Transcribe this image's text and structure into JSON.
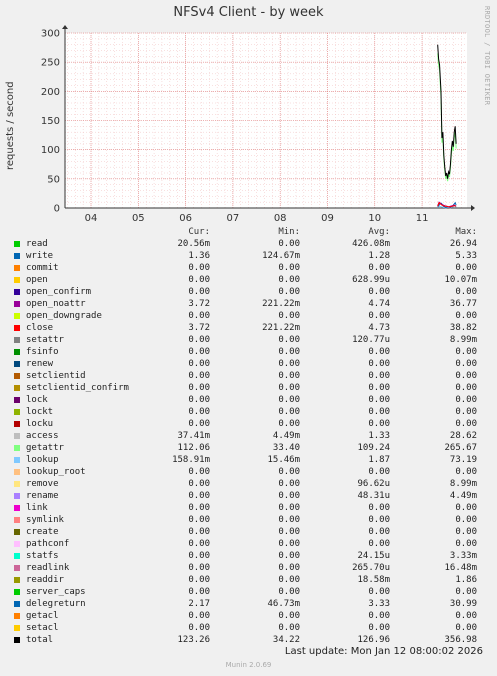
{
  "title": "NFSv4 Client - by week",
  "side_text": "RRDTOOL / TOBI OETIKER",
  "footer": {
    "last_update": "Last update: Mon Jan 12 08:00:02 2026",
    "version": "Munin 2.0.69"
  },
  "legend_headers": [
    "Cur:",
    "Min:",
    "Avg:",
    "Max:"
  ],
  "legend": [
    {
      "name": "read",
      "color": "#00cc00",
      "cur": "20.56m",
      "min": "0.00",
      "avg": "426.08m",
      "max": "26.94"
    },
    {
      "name": "write",
      "color": "#0066b3",
      "cur": "1.36",
      "min": "124.67m",
      "avg": "1.28",
      "max": "5.33"
    },
    {
      "name": "commit",
      "color": "#ff8000",
      "cur": "0.00",
      "min": "0.00",
      "avg": "0.00",
      "max": "0.00"
    },
    {
      "name": "open",
      "color": "#ffcc00",
      "cur": "0.00",
      "min": "0.00",
      "avg": "628.99u",
      "max": "10.07m"
    },
    {
      "name": "open_confirm",
      "color": "#330099",
      "cur": "0.00",
      "min": "0.00",
      "avg": "0.00",
      "max": "0.00"
    },
    {
      "name": "open_noattr",
      "color": "#990099",
      "cur": "3.72",
      "min": "221.22m",
      "avg": "4.74",
      "max": "36.77"
    },
    {
      "name": "open_downgrade",
      "color": "#ccff00",
      "cur": "0.00",
      "min": "0.00",
      "avg": "0.00",
      "max": "0.00"
    },
    {
      "name": "close",
      "color": "#ff0000",
      "cur": "3.72",
      "min": "221.22m",
      "avg": "4.73",
      "max": "38.82"
    },
    {
      "name": "setattr",
      "color": "#808080",
      "cur": "0.00",
      "min": "0.00",
      "avg": "120.77u",
      "max": "8.99m"
    },
    {
      "name": "fsinfo",
      "color": "#008f00",
      "cur": "0.00",
      "min": "0.00",
      "avg": "0.00",
      "max": "0.00"
    },
    {
      "name": "renew",
      "color": "#00487d",
      "cur": "0.00",
      "min": "0.00",
      "avg": "0.00",
      "max": "0.00"
    },
    {
      "name": "setclientid",
      "color": "#b35a00",
      "cur": "0.00",
      "min": "0.00",
      "avg": "0.00",
      "max": "0.00"
    },
    {
      "name": "setclientid_confirm",
      "color": "#b38f00",
      "cur": "0.00",
      "min": "0.00",
      "avg": "0.00",
      "max": "0.00"
    },
    {
      "name": "lock",
      "color": "#6b006b",
      "cur": "0.00",
      "min": "0.00",
      "avg": "0.00",
      "max": "0.00"
    },
    {
      "name": "lockt",
      "color": "#8fb300",
      "cur": "0.00",
      "min": "0.00",
      "avg": "0.00",
      "max": "0.00"
    },
    {
      "name": "locku",
      "color": "#b30000",
      "cur": "0.00",
      "min": "0.00",
      "avg": "0.00",
      "max": "0.00"
    },
    {
      "name": "access",
      "color": "#bebebe",
      "cur": "37.41m",
      "min": "4.49m",
      "avg": "1.33",
      "max": "28.62"
    },
    {
      "name": "getattr",
      "color": "#80ff80",
      "cur": "112.06",
      "min": "33.40",
      "avg": "109.24",
      "max": "265.67"
    },
    {
      "name": "lookup",
      "color": "#80c9ff",
      "cur": "158.91m",
      "min": "15.46m",
      "avg": "1.87",
      "max": "73.19"
    },
    {
      "name": "lookup_root",
      "color": "#ffc080",
      "cur": "0.00",
      "min": "0.00",
      "avg": "0.00",
      "max": "0.00"
    },
    {
      "name": "remove",
      "color": "#ffe680",
      "cur": "0.00",
      "min": "0.00",
      "avg": "96.62u",
      "max": "8.99m"
    },
    {
      "name": "rename",
      "color": "#aa80ff",
      "cur": "0.00",
      "min": "0.00",
      "avg": "48.31u",
      "max": "4.49m"
    },
    {
      "name": "link",
      "color": "#ee00cc",
      "cur": "0.00",
      "min": "0.00",
      "avg": "0.00",
      "max": "0.00"
    },
    {
      "name": "symlink",
      "color": "#ff8080",
      "cur": "0.00",
      "min": "0.00",
      "avg": "0.00",
      "max": "0.00"
    },
    {
      "name": "create",
      "color": "#666600",
      "cur": "0.00",
      "min": "0.00",
      "avg": "0.00",
      "max": "0.00"
    },
    {
      "name": "pathconf",
      "color": "#ffbfff",
      "cur": "0.00",
      "min": "0.00",
      "avg": "0.00",
      "max": "0.00"
    },
    {
      "name": "statfs",
      "color": "#00ffcc",
      "cur": "0.00",
      "min": "0.00",
      "avg": "24.15u",
      "max": "3.33m"
    },
    {
      "name": "readlink",
      "color": "#cc6699",
      "cur": "0.00",
      "min": "0.00",
      "avg": "265.70u",
      "max": "16.48m"
    },
    {
      "name": "readdir",
      "color": "#999900",
      "cur": "0.00",
      "min": "0.00",
      "avg": "18.58m",
      "max": "1.86"
    },
    {
      "name": "server_caps",
      "color": "#00cc00",
      "cur": "0.00",
      "min": "0.00",
      "avg": "0.00",
      "max": "0.00"
    },
    {
      "name": "delegreturn",
      "color": "#0066b3",
      "cur": "2.17",
      "min": "46.73m",
      "avg": "3.33",
      "max": "30.99"
    },
    {
      "name": "getacl",
      "color": "#ff8000",
      "cur": "0.00",
      "min": "0.00",
      "avg": "0.00",
      "max": "0.00"
    },
    {
      "name": "setacl",
      "color": "#ffcc00",
      "cur": "0.00",
      "min": "0.00",
      "avg": "0.00",
      "max": "0.00"
    },
    {
      "name": "total",
      "color": "#000000",
      "cur": "123.26",
      "min": "34.22",
      "avg": "126.96",
      "max": "356.98"
    }
  ],
  "chart_data": {
    "type": "line",
    "title": "NFSv4 Client - by week",
    "ylabel": "requests / second",
    "xlabel": "",
    "ylim": [
      0,
      300
    ],
    "yticks": [
      0,
      50,
      100,
      150,
      200,
      250,
      300
    ],
    "xlim": [
      3.45,
      11.95
    ],
    "xticks": [
      "04",
      "05",
      "06",
      "07",
      "08",
      "09",
      "10",
      "11"
    ],
    "grid": true,
    "series": [
      {
        "name": "total",
        "color": "#000000",
        "x": [
          11.33,
          11.35,
          11.37,
          11.4,
          11.42,
          11.44,
          11.46,
          11.48,
          11.5,
          11.52,
          11.54,
          11.56,
          11.58,
          11.6,
          11.62,
          11.64,
          11.66,
          11.68,
          11.7,
          11.72
        ],
        "values": [
          280,
          255,
          245,
          200,
          120,
          130,
          90,
          70,
          55,
          60,
          50,
          62,
          58,
          75,
          100,
          115,
          105,
          130,
          140,
          110
        ]
      },
      {
        "name": "getattr",
        "color": "#80ff80",
        "x": [
          11.33,
          11.35,
          11.37,
          11.4,
          11.42,
          11.44,
          11.46,
          11.48,
          11.5,
          11.52,
          11.54,
          11.56,
          11.58,
          11.6,
          11.62,
          11.64,
          11.66,
          11.68,
          11.7,
          11.72
        ],
        "values": [
          265,
          245,
          236,
          190,
          112,
          120,
          84,
          64,
          50,
          55,
          46,
          57,
          53,
          69,
          92,
          106,
          98,
          120,
          130,
          102
        ]
      },
      {
        "name": "open_noattr",
        "color": "#990099",
        "x": [
          11.33,
          11.36,
          11.39,
          11.42,
          11.45,
          11.48,
          11.52,
          11.56,
          11.6,
          11.64,
          11.68,
          11.72
        ],
        "values": [
          4,
          10,
          8,
          6,
          5,
          4,
          3,
          2,
          3,
          4,
          5,
          3
        ]
      },
      {
        "name": "close",
        "color": "#ff0000",
        "x": [
          11.33,
          11.36,
          11.39,
          11.42,
          11.45,
          11.48,
          11.52,
          11.56,
          11.6,
          11.64,
          11.68,
          11.72
        ],
        "values": [
          3,
          9,
          7,
          5,
          4,
          3,
          3,
          2,
          2,
          3,
          4,
          3
        ]
      },
      {
        "name": "write",
        "color": "#0066b3",
        "x": [
          11.33,
          11.37,
          11.41,
          11.45,
          11.5,
          11.55,
          11.6,
          11.65,
          11.7,
          11.72
        ],
        "values": [
          2,
          6,
          8,
          3,
          1,
          2,
          1,
          4,
          9,
          5
        ]
      },
      {
        "name": "lookup",
        "color": "#80c9ff",
        "x": [
          11.33,
          11.37,
          11.41,
          11.45,
          11.5,
          11.55,
          11.6,
          11.65,
          11.7,
          11.72
        ],
        "values": [
          1,
          3,
          2,
          1,
          0.5,
          1,
          0.5,
          2,
          4,
          1
        ]
      }
    ]
  }
}
